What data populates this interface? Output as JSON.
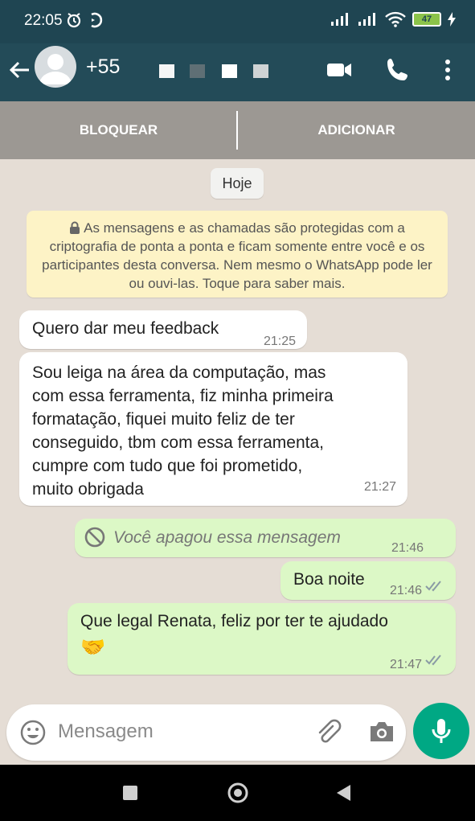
{
  "status_bar": {
    "time": "22:05",
    "battery": "47"
  },
  "header": {
    "contact_name": "+55",
    "icons": [
      "back-arrow-icon",
      "avatar-icon",
      "video-call-icon",
      "phone-icon",
      "more-vertical-icon"
    ]
  },
  "actions": {
    "block_label": "BLOQUEAR",
    "add_label": "ADICIONAR"
  },
  "chat": {
    "date_chip": "Hoje",
    "encryption_notice": "As mensagens e as chamadas são protegidas com a criptografia de ponta a ponta e ficam somente entre você e os participantes desta conversa. Nem mesmo o WhatsApp pode ler ou ouvi-las. Toque para saber mais.",
    "messages": [
      {
        "direction": "in",
        "text": "Quero dar meu feedback",
        "time": "21:25"
      },
      {
        "direction": "in",
        "lines": [
          "Sou leiga na área da computação, mas",
          "com essa ferramenta, fiz minha primeira",
          "formatação, fiquei muito feliz de ter",
          "conseguido, tbm com essa ferramenta,",
          "cumpre com tudo que foi prometido,",
          "muito obrigada"
        ],
        "time": "21:27"
      },
      {
        "direction": "out",
        "text": "Você apagou essa mensagem",
        "deleted": true,
        "time": "21:46"
      },
      {
        "direction": "out",
        "text": "Boa noite",
        "time": "21:46",
        "status": "read"
      },
      {
        "direction": "out",
        "text": "Que legal Renata, feliz por ter te ajudado",
        "emoji": "🤝",
        "time": "21:47",
        "status": "read"
      }
    ]
  },
  "composer": {
    "placeholder": "Mensagem",
    "icons": [
      "emoji-icon",
      "attach-icon",
      "camera-icon",
      "mic-icon"
    ]
  },
  "colors": {
    "header": "#234b58",
    "status_bar": "#1f4552",
    "chat_bg": "#e5ddd5",
    "outgoing_bubble": "#dcf8c6",
    "incoming_bubble": "#ffffff",
    "accent": "#00a884",
    "read_ticks": "#8a9ba5"
  }
}
